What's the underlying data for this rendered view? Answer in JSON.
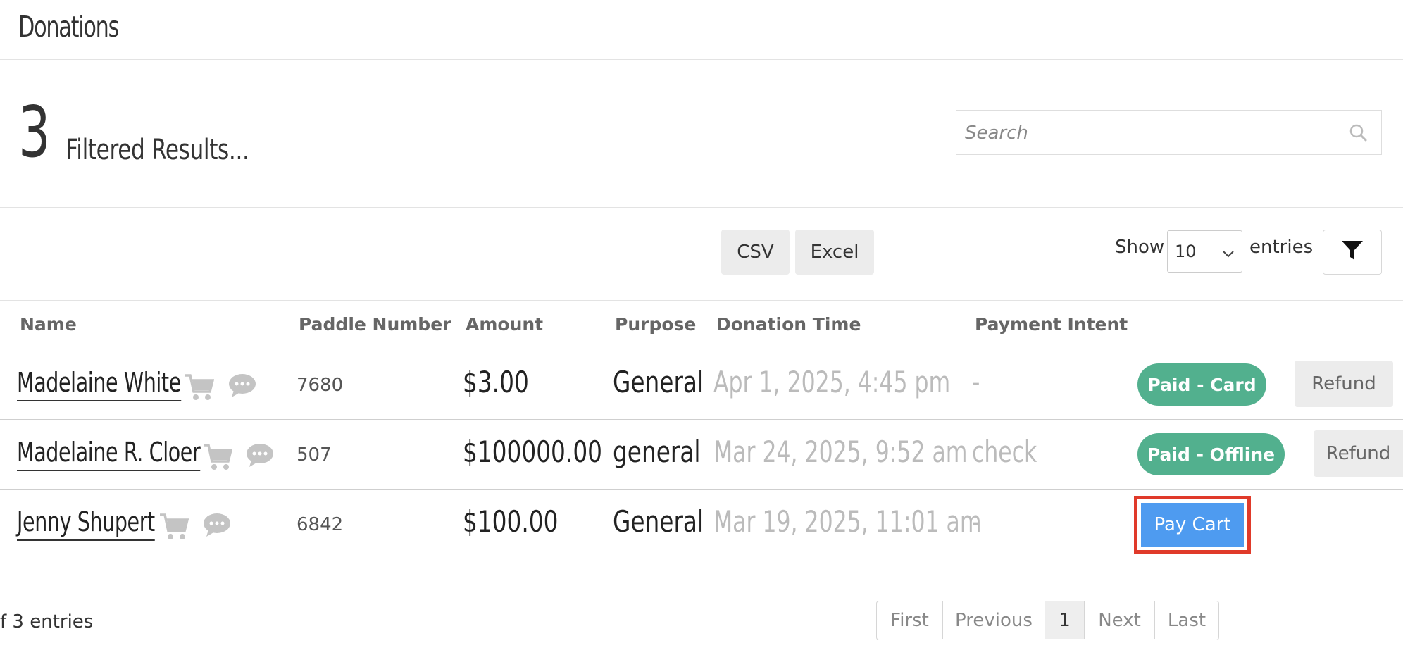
{
  "header": {
    "title": "Donations"
  },
  "summary": {
    "count": "3",
    "label": "Filtered Results..."
  },
  "search": {
    "placeholder": "Search",
    "value": ""
  },
  "toolbar": {
    "csv_label": "CSV",
    "excel_label": "Excel",
    "show_label": "Show",
    "entries_value": "10",
    "entries_label": "entries"
  },
  "table": {
    "columns": [
      "Name",
      "Paddle Number",
      "Amount",
      "Purpose",
      "Donation Time",
      "Payment Intent"
    ],
    "rows": [
      {
        "name": "Madelaine White",
        "paddle": "7680",
        "amount": "$3.00",
        "purpose": "General",
        "time": "Apr 1, 2025, 4:45 pm",
        "intent": "-",
        "status": "Paid - Card",
        "action": "Refund"
      },
      {
        "name": "Madelaine R. Cloer",
        "paddle": "507",
        "amount": "$100000.00",
        "purpose": "general",
        "time": "Mar 24, 2025, 9:52 am",
        "intent": "check",
        "status": "Paid - Offline",
        "action": "Refund"
      },
      {
        "name": "Jenny Shupert",
        "paddle": "6842",
        "amount": "$100.00",
        "purpose": "General",
        "time": "Mar 19, 2025, 11:01 am",
        "intent": "-",
        "action": "Pay Cart"
      }
    ]
  },
  "footer": {
    "info": "f 3 entries"
  },
  "pagination": {
    "first": "First",
    "previous": "Previous",
    "current": "1",
    "next": "Next",
    "last": "Last"
  },
  "colors": {
    "paid": "#52b08e",
    "pay_cart": "#4e9bf0",
    "highlight": "#e03a2a"
  }
}
